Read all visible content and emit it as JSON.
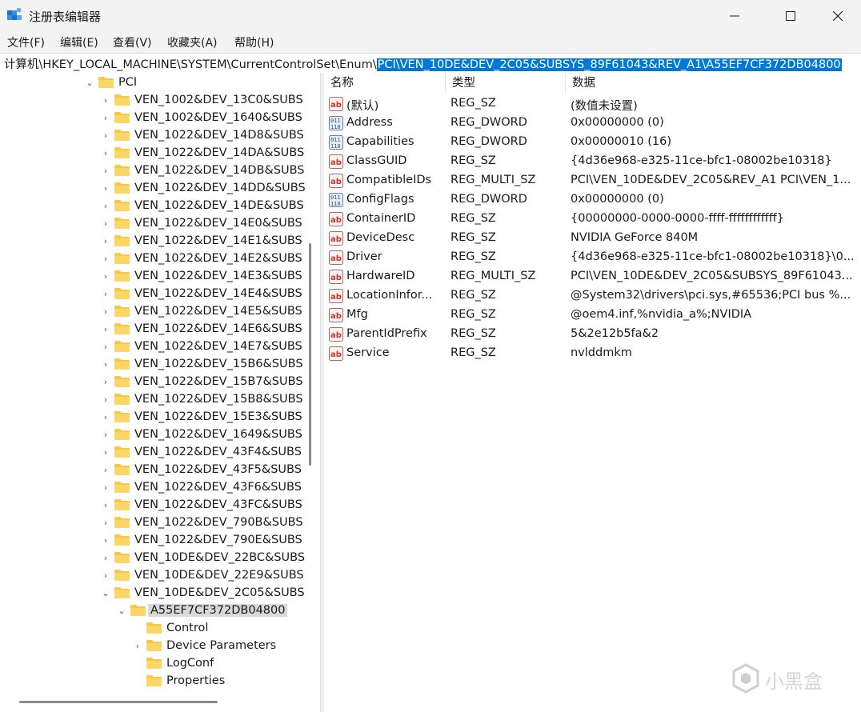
{
  "window": {
    "title": "注册表编辑器"
  },
  "menu": [
    "文件(F)",
    "编辑(E)",
    "查看(V)",
    "收藏夹(A)",
    "帮助(H)"
  ],
  "address": {
    "prefix": "计算机\\HKEY_LOCAL_MACHINE\\SYSTEM\\CurrentControlSet\\Enum\\",
    "selected": "PCI\\VEN_10DE&DEV_2C05&SUBSYS_89F61043&REV_A1\\A55EF7CF372DB04800"
  },
  "tree": {
    "root": {
      "label": "PCI",
      "expanded": true
    },
    "vendors": [
      "VEN_1002&DEV_13C0&SUBS",
      "VEN_1002&DEV_1640&SUBS",
      "VEN_1022&DEV_14D8&SUBS",
      "VEN_1022&DEV_14DA&SUBS",
      "VEN_1022&DEV_14DB&SUBS",
      "VEN_1022&DEV_14DD&SUBS",
      "VEN_1022&DEV_14DE&SUBS",
      "VEN_1022&DEV_14E0&SUBS",
      "VEN_1022&DEV_14E1&SUBS",
      "VEN_1022&DEV_14E2&SUBS",
      "VEN_1022&DEV_14E3&SUBS",
      "VEN_1022&DEV_14E4&SUBS",
      "VEN_1022&DEV_14E5&SUBS",
      "VEN_1022&DEV_14E6&SUBS",
      "VEN_1022&DEV_14E7&SUBS",
      "VEN_1022&DEV_15B6&SUBS",
      "VEN_1022&DEV_15B7&SUBS",
      "VEN_1022&DEV_15B8&SUBS",
      "VEN_1022&DEV_15E3&SUBS",
      "VEN_1022&DEV_1649&SUBS",
      "VEN_1022&DEV_43F4&SUBS",
      "VEN_1022&DEV_43F5&SUBS",
      "VEN_1022&DEV_43F6&SUBS",
      "VEN_1022&DEV_43FC&SUBS",
      "VEN_1022&DEV_790B&SUBS",
      "VEN_1022&DEV_790E&SUBS",
      "VEN_10DE&DEV_22BC&SUBS",
      "VEN_10DE&DEV_22E9&SUBS",
      "VEN_10DE&DEV_2C05&SUBS"
    ],
    "instance": "A55EF7CF372DB04800",
    "children": [
      {
        "label": "Control",
        "expandable": false
      },
      {
        "label": "Device Parameters",
        "expandable": true
      },
      {
        "label": "LogConf",
        "expandable": false
      },
      {
        "label": "Properties",
        "expandable": false
      }
    ]
  },
  "columns": {
    "name": "名称",
    "type": "类型",
    "data": "数据"
  },
  "values": [
    {
      "name": "(默认)",
      "type": "REG_SZ",
      "data": "(数值未设置)",
      "icon": "string-value-icon"
    },
    {
      "name": "Address",
      "type": "REG_DWORD",
      "data": "0x00000000 (0)",
      "icon": "binary-value-icon"
    },
    {
      "name": "Capabilities",
      "type": "REG_DWORD",
      "data": "0x00000010 (16)",
      "icon": "binary-value-icon"
    },
    {
      "name": "ClassGUID",
      "type": "REG_SZ",
      "data": "{4d36e968-e325-11ce-bfc1-08002be10318}",
      "icon": "string-value-icon"
    },
    {
      "name": "CompatibleIDs",
      "type": "REG_MULTI_SZ",
      "data": "PCI\\VEN_10DE&DEV_2C05&REV_A1 PCI\\VEN_1...",
      "icon": "string-value-icon"
    },
    {
      "name": "ConfigFlags",
      "type": "REG_DWORD",
      "data": "0x00000000 (0)",
      "icon": "binary-value-icon"
    },
    {
      "name": "ContainerID",
      "type": "REG_SZ",
      "data": "{00000000-0000-0000-ffff-ffffffffffff}",
      "icon": "string-value-icon"
    },
    {
      "name": "DeviceDesc",
      "type": "REG_SZ",
      "data": "NVIDIA GeForce 840M",
      "icon": "string-value-icon"
    },
    {
      "name": "Driver",
      "type": "REG_SZ",
      "data": "{4d36e968-e325-11ce-bfc1-08002be10318}\\0...",
      "icon": "string-value-icon"
    },
    {
      "name": "HardwareID",
      "type": "REG_MULTI_SZ",
      "data": "PCI\\VEN_10DE&DEV_2C05&SUBSYS_89F61043...",
      "icon": "string-value-icon"
    },
    {
      "name": "LocationInfor...",
      "type": "REG_SZ",
      "data": "@System32\\drivers\\pci.sys,#65536;PCI bus %...",
      "icon": "string-value-icon"
    },
    {
      "name": "Mfg",
      "type": "REG_SZ",
      "data": "@oem4.inf,%nvidia_a%;NVIDIA",
      "icon": "string-value-icon"
    },
    {
      "name": "ParentIdPrefix",
      "type": "REG_SZ",
      "data": "5&2e12b5fa&2",
      "icon": "string-value-icon"
    },
    {
      "name": "Service",
      "type": "REG_SZ",
      "data": "nvlddmkm",
      "icon": "string-value-icon"
    }
  ],
  "watermark": {
    "text": "小黑盒"
  },
  "colors": {
    "selection": "#0078d7",
    "folder": "#f8c84a",
    "titlebar": "#f3f3f3"
  }
}
